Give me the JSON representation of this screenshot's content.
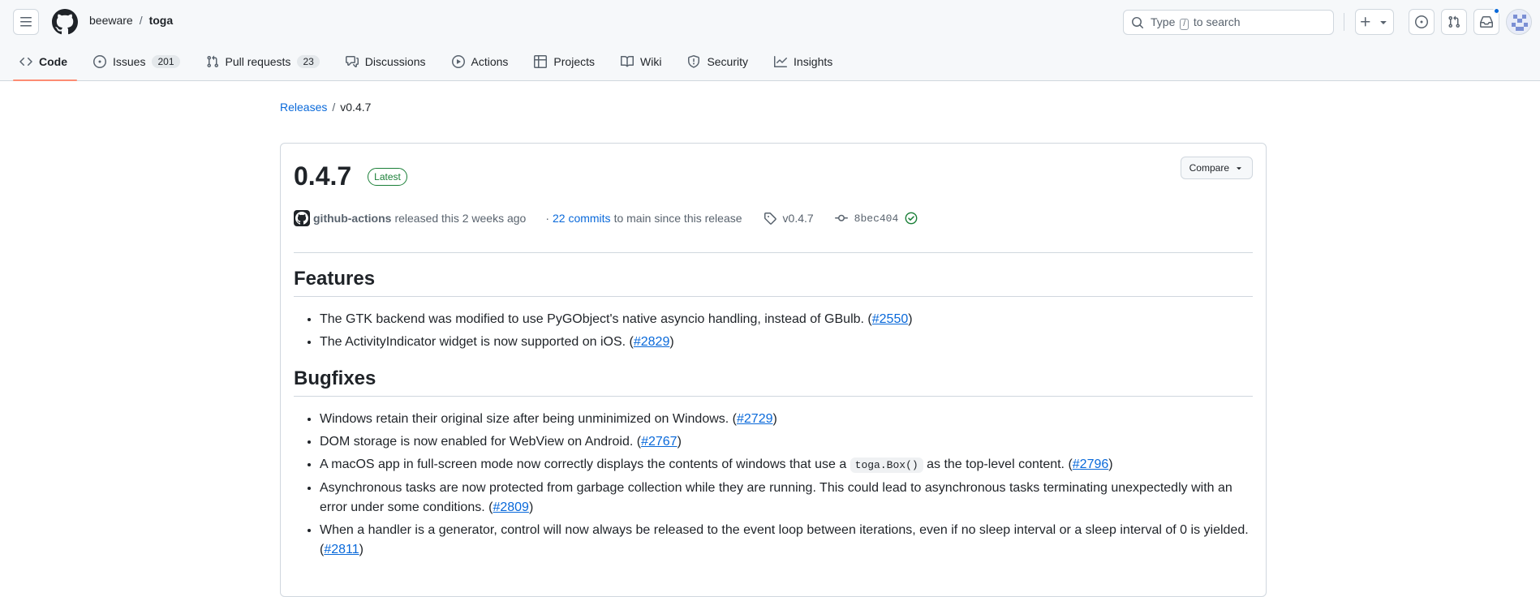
{
  "header": {
    "owner": "beeware",
    "separator": "/",
    "repo": "toga",
    "search": {
      "prefix": "Type",
      "key": "/",
      "suffix": "to search"
    }
  },
  "nav": {
    "tabs": [
      {
        "label": "Code",
        "icon": "code-icon",
        "selected": true
      },
      {
        "label": "Issues",
        "icon": "issue-icon",
        "count": "201"
      },
      {
        "label": "Pull requests",
        "icon": "pull-request-icon",
        "count": "23"
      },
      {
        "label": "Discussions",
        "icon": "discussions-icon"
      },
      {
        "label": "Actions",
        "icon": "actions-icon"
      },
      {
        "label": "Projects",
        "icon": "projects-icon"
      },
      {
        "label": "Wiki",
        "icon": "wiki-icon"
      },
      {
        "label": "Security",
        "icon": "security-icon"
      },
      {
        "label": "Insights",
        "icon": "insights-icon"
      }
    ]
  },
  "breadcrumb": {
    "releases": "Releases",
    "separator": "/",
    "current": "v0.4.7"
  },
  "release": {
    "title": "0.4.7",
    "badge": "Latest",
    "compare_label": "Compare",
    "author": "github-actions",
    "released_text": "released this 2 weeks ago",
    "commits_prefix": "·",
    "commits_link": "22 commits",
    "commits_suffix": "to main since this release",
    "tag": "v0.4.7",
    "sha": "8bec404"
  },
  "sections": [
    {
      "heading": "Features",
      "items": [
        {
          "text": "The GTK backend was modified to use PyGObject's native asyncio handling, instead of GBulb. (",
          "link": "#2550",
          "after": ")"
        },
        {
          "text": "The ActivityIndicator widget is now supported on iOS. (",
          "link": "#2829",
          "after": ")"
        }
      ]
    },
    {
      "heading": "Bugfixes",
      "items": [
        {
          "text": "Windows retain their original size after being unminimized on Windows. (",
          "link": "#2729",
          "after": ")"
        },
        {
          "text": "DOM storage is now enabled for WebView on Android. (",
          "link": "#2767",
          "after": ")"
        },
        {
          "text": "A macOS app in full-screen mode now correctly displays the contents of windows that use a ",
          "code": "toga.Box()",
          "text2": " as the top-level content. (",
          "link": "#2796",
          "after": ")"
        },
        {
          "text": "Asynchronous tasks are now protected from garbage collection while they are running. This could lead to asynchronous tasks terminating unexpectedly with an error under some conditions. (",
          "link": "#2809",
          "after": ")"
        },
        {
          "text": "When a handler is a generator, control will now always be released to the event loop between iterations, even if no sleep interval or a sleep interval of 0 is yielded. (",
          "link": "#2811",
          "after": ")"
        }
      ]
    }
  ],
  "colors": {
    "accent": "#0969da",
    "tab_underline": "#fd8c73",
    "latest_green": "#1a7f37"
  }
}
